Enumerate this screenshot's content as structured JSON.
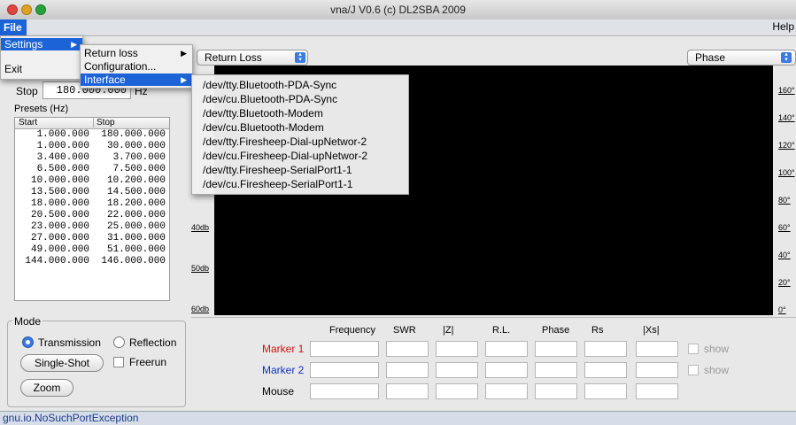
{
  "window": {
    "title": "vna/J V0.6 (c) DL2SBA 2009"
  },
  "menubar": {
    "file": "File",
    "help": "Help"
  },
  "file_menu": {
    "settings": "Settings",
    "exit": "Exit"
  },
  "settings_menu": {
    "return_loss": "Return loss",
    "configuration": "Configuration...",
    "interface": "Interface"
  },
  "interface_menu": {
    "items": [
      "/dev/tty.Bluetooth-PDA-Sync",
      "/dev/cu.Bluetooth-PDA-Sync",
      "/dev/tty.Bluetooth-Modem",
      "/dev/cu.Bluetooth-Modem",
      "/dev/tty.Firesheep-Dial-upNetwor-2",
      "/dev/cu.Firesheep-Dial-upNetwor-2",
      "/dev/tty.Firesheep-SerialPort1-1",
      "/dev/cu.Firesheep-SerialPort1-1"
    ]
  },
  "sweep": {
    "stop_label": "Stop",
    "stop_value": "180.000.000",
    "stop_unit": "Hz"
  },
  "presets": {
    "title": "Presets (Hz)",
    "columns": [
      "Start",
      "Stop"
    ],
    "rows": [
      [
        "1.000.000",
        "180.000.000"
      ],
      [
        "1.000.000",
        "30.000.000"
      ],
      [
        "3.400.000",
        "3.700.000"
      ],
      [
        "6.500.000",
        "7.500.000"
      ],
      [
        "10.000.000",
        "10.200.000"
      ],
      [
        "13.500.000",
        "14.500.000"
      ],
      [
        "18.000.000",
        "18.200.000"
      ],
      [
        "20.500.000",
        "22.000.000"
      ],
      [
        "23.000.000",
        "25.000.000"
      ],
      [
        "27.000.000",
        "31.000.000"
      ],
      [
        "49.000.000",
        "51.000.000"
      ],
      [
        "144.000.000",
        "146.000.000"
      ]
    ]
  },
  "mode": {
    "title": "Mode",
    "transmission": "Transmission",
    "reflection": "Reflection",
    "single_shot": "Single-Shot",
    "freerun": "Freerun",
    "zoom": "Zoom"
  },
  "graph": {
    "left_select": "Return Loss",
    "right_select": "Phase",
    "left_axis": [
      "40db",
      "50db",
      "60db"
    ],
    "right_axis": [
      "160°",
      "140°",
      "120°",
      "100°",
      "80°",
      "60°",
      "40°",
      "20°",
      "0°"
    ]
  },
  "markers": {
    "columns": [
      "Frequency",
      "SWR",
      "|Z|",
      "R.L.",
      "Phase",
      "Rs",
      "|Xs|"
    ],
    "rows": [
      {
        "label": "Marker 1",
        "color": "#d01010"
      },
      {
        "label": "Marker 2",
        "color": "#1030c0"
      },
      {
        "label": "Mouse",
        "color": "#000000"
      }
    ],
    "show": "show"
  },
  "status": {
    "text": "gnu.io.NoSuchPortException"
  }
}
